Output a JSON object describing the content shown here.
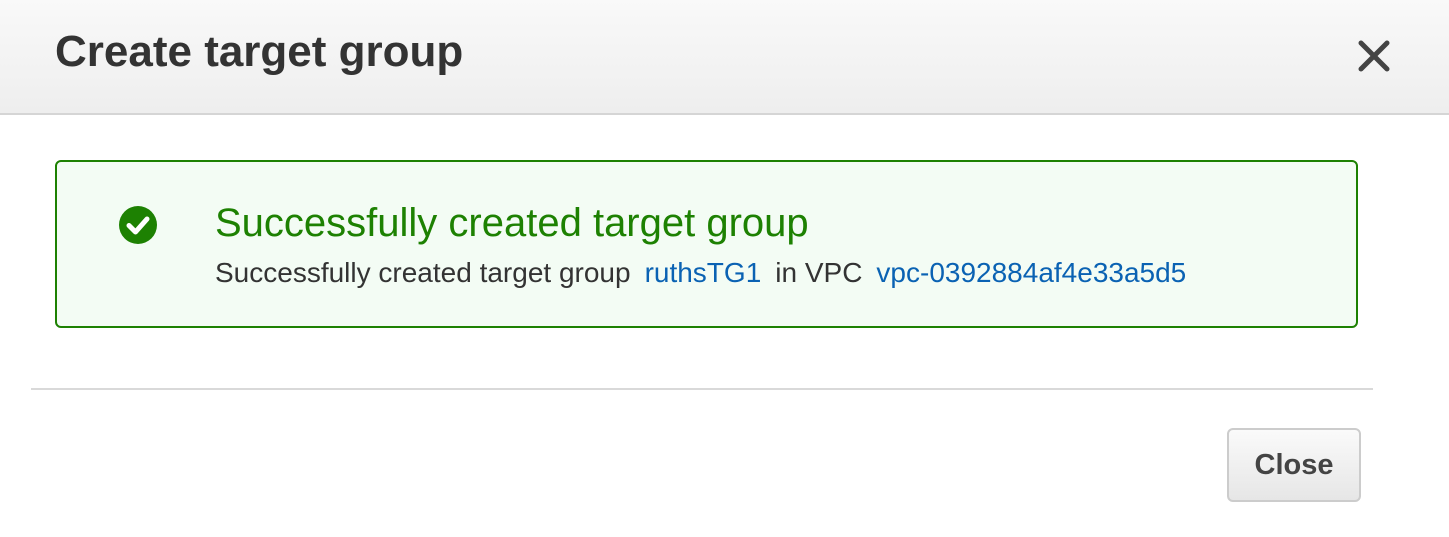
{
  "dialog": {
    "title": "Create target group",
    "close_icon": "close-icon"
  },
  "alert": {
    "status": "success",
    "icon": "check-circle-icon",
    "title": "Successfully created target group",
    "message_prefix": "Successfully created target group",
    "target_group_link": "ruthsTG1",
    "message_middle": "in VPC",
    "vpc_link": "vpc-0392884af4e33a5d5",
    "colors": {
      "success_green": "#1d8102",
      "background": "#f3fcf4",
      "link_blue": "#0a62b3"
    }
  },
  "footer": {
    "close_label": "Close"
  }
}
